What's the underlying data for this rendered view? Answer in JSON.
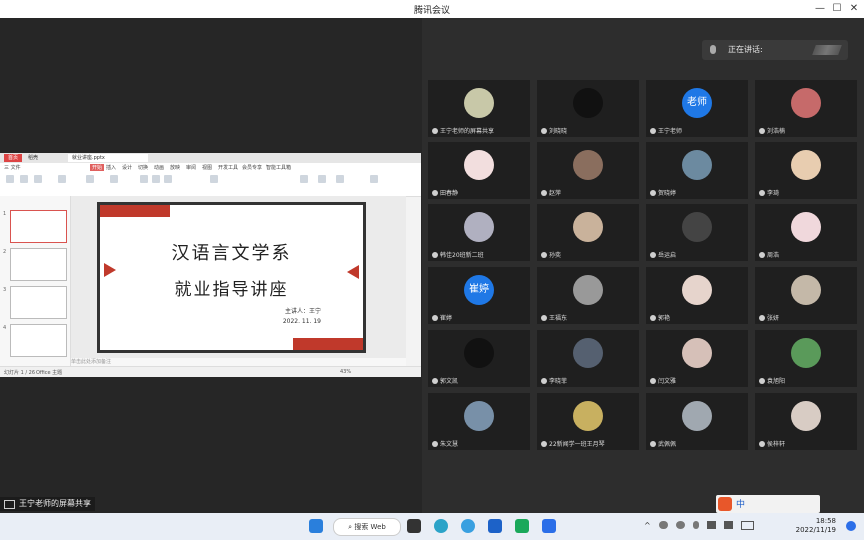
{
  "app": {
    "title": "腾讯会议"
  },
  "speaking": {
    "label": "正在讲话:"
  },
  "participants": [
    {
      "name": "王宁老师的屏幕共享",
      "avatar": "landscape-avatar",
      "color": "#c8c8a8"
    },
    {
      "name": "刘晓晓",
      "avatar": "cat-avatar",
      "color": "#111111"
    },
    {
      "name": "王宁老师",
      "avatar_text": "老师",
      "color": "#1f78e6"
    },
    {
      "name": "刘浩楠",
      "avatar": "sunset-avatar",
      "color": "#c66a6a"
    },
    {
      "name": "田春静",
      "avatar": "cartoon-avatar",
      "color": "#f2dede"
    },
    {
      "name": "赵萍",
      "avatar": "anime-avatar",
      "color": "#8a6e5e"
    },
    {
      "name": "贺晓婷",
      "avatar": "anime-avatar",
      "color": "#6c8aa0"
    },
    {
      "name": "李琦",
      "avatar": "girl-avatar",
      "color": "#e8cdb0"
    },
    {
      "name": "韩佳20班新二班",
      "avatar": "robot-avatar",
      "color": "#b0b0c0"
    },
    {
      "name": "孙奕",
      "avatar": "girl-avatar",
      "color": "#c9b29b"
    },
    {
      "name": "岳运启",
      "avatar": "anime-avatar",
      "color": "#444444"
    },
    {
      "name": "周浩",
      "avatar": "cute-avatar",
      "color": "#f0d8dc"
    },
    {
      "name": "崔婷",
      "avatar_text": "崔婷",
      "color": "#1f78e6"
    },
    {
      "name": "王福东",
      "avatar": "ink-avatar",
      "color": "#999999"
    },
    {
      "name": "郭艳",
      "avatar": "girl-avatar",
      "color": "#e6d4cc"
    },
    {
      "name": "张妍",
      "avatar": "girl-avatar",
      "color": "#c4b8a8"
    },
    {
      "name": "郭文凯",
      "avatar": "silhouette-avatar",
      "color": "#111111"
    },
    {
      "name": "李晓菲",
      "avatar": "anime-avatar",
      "color": "#556070"
    },
    {
      "name": "闫文雅",
      "avatar": "anime-avatar",
      "color": "#d6c0b8"
    },
    {
      "name": "袁旭阳",
      "avatar": "game-avatar",
      "color": "#5a9a5a"
    },
    {
      "name": "朱文慧",
      "avatar": "landscape-avatar",
      "color": "#7890a8"
    },
    {
      "name": "22新闻学一班王月琴",
      "avatar": "flower-avatar",
      "color": "#c8b060"
    },
    {
      "name": "武佩佩",
      "avatar": "building-avatar",
      "color": "#a0a8b0"
    },
    {
      "name": "侯梓轩",
      "avatar": "anime-avatar",
      "color": "#d8ccc4"
    }
  ],
  "ppt": {
    "tabs": [
      "首页",
      "稻壳",
      "就业讲座.pptx"
    ],
    "menu": [
      "三 文件",
      "开始",
      "插入",
      "设计",
      "切换",
      "动画",
      "放映",
      "审阅",
      "视图",
      "开发工具",
      "会员专享",
      "智能工具箱"
    ],
    "slide_title_1": "汉语言文学系",
    "slide_title_2": "就业指导讲座",
    "presenter": "主讲人：王宁",
    "date": "2022. 11. 19",
    "note_placeholder": "单击此处添加备注",
    "status_left": "幻灯片 1 / 26",
    "status_theme": "Office 主题",
    "zoom": "43%"
  },
  "share_label": "王宁老师的屏幕共享",
  "taskbar": {
    "search_placeholder": "搜索 Web",
    "time": "18:58",
    "date": "2022/11/19"
  },
  "ime": {
    "label": "中"
  }
}
